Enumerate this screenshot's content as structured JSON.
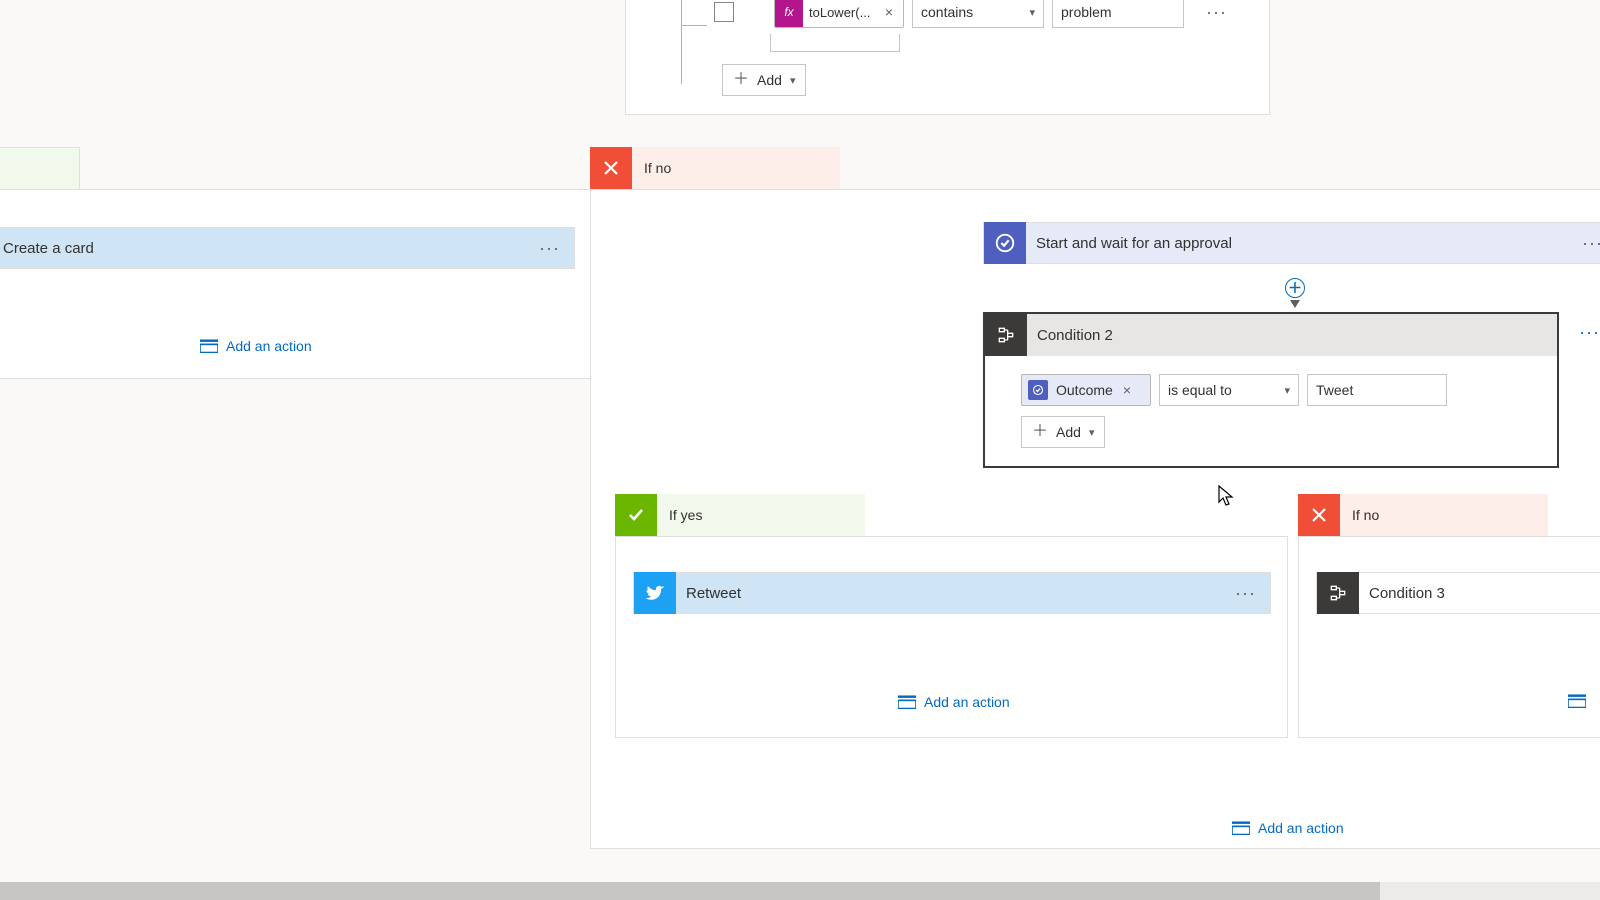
{
  "top_condition": {
    "expr_token": "toLower(...",
    "operator": "contains",
    "value": "problem",
    "add_label": "Add"
  },
  "branches": {
    "yes_label": "If yes",
    "no_label": "If no"
  },
  "create_card": {
    "title": "Create a card"
  },
  "approval": {
    "title": "Start and wait for an approval"
  },
  "condition2": {
    "title": "Condition 2",
    "token": "Outcome",
    "operator": "is equal to",
    "value": "Tweet",
    "add_label": "Add"
  },
  "retweet": {
    "title": "Retweet"
  },
  "condition3": {
    "title": "Condition 3"
  },
  "add_action_label": "Add an action",
  "colors": {
    "accent_blue": "#036ac4",
    "green": "#6bb700",
    "red": "#f04e37",
    "purple": "#4e5fbf",
    "pink_fx": "#b4158c",
    "twitter": "#1da1f2",
    "dark": "#3b3a39"
  }
}
